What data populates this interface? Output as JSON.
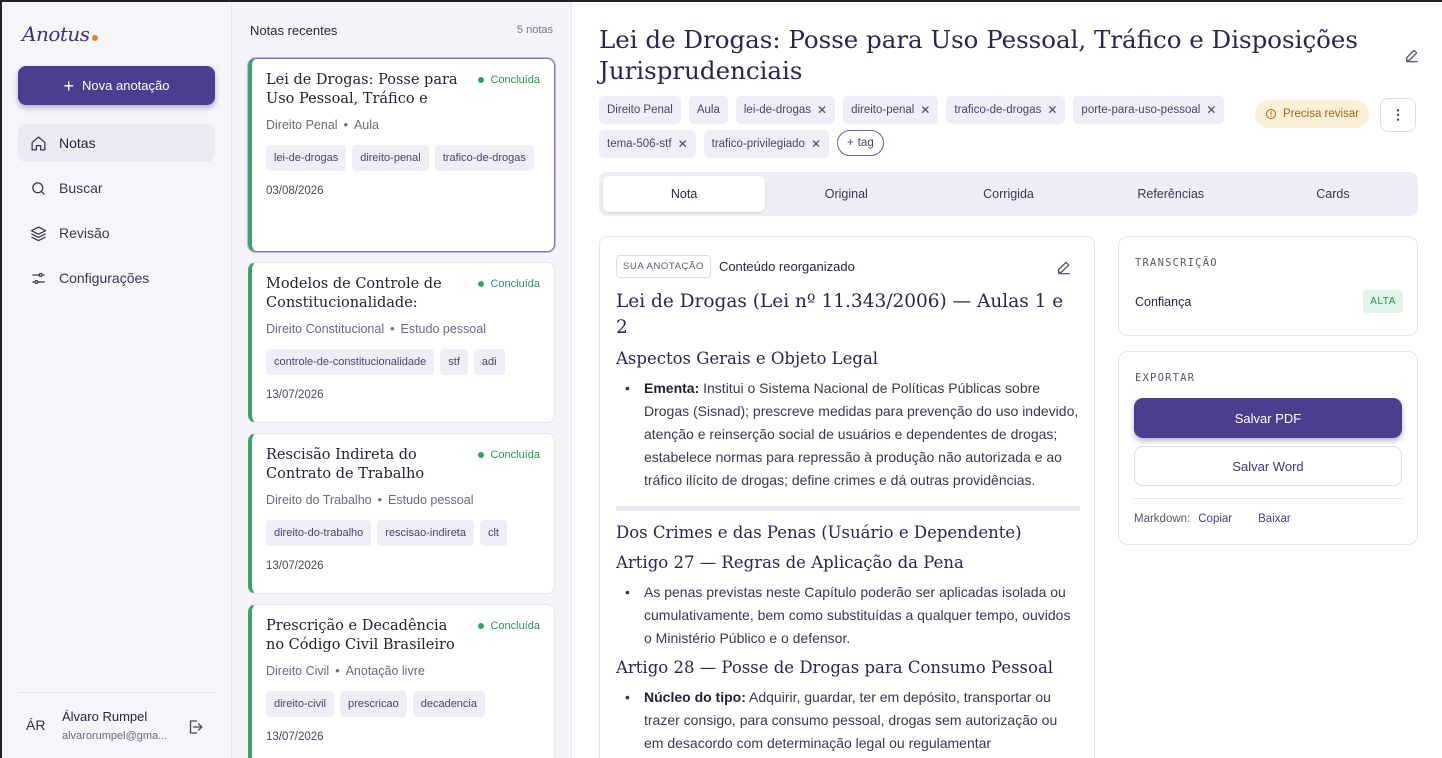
{
  "app": {
    "logo": "Anotus",
    "new_note_label": "Nova anotação"
  },
  "nav": [
    {
      "label": "Notas",
      "icon": "home-icon",
      "active": true
    },
    {
      "label": "Buscar",
      "icon": "search-icon"
    },
    {
      "label": "Revisão",
      "icon": "layers-icon"
    },
    {
      "label": "Configurações",
      "icon": "sliders-icon"
    }
  ],
  "user": {
    "initials": "ÁR",
    "name": "Álvaro Rumpel",
    "email": "alvarorumpel@gma..."
  },
  "notes_list": {
    "header": "Notas recentes",
    "count": "5 notas",
    "cards": [
      {
        "title": "Lei de Drogas: Posse para Uso Pessoal, Tráfico e Dis...",
        "status": "Concluída",
        "area": "Direito Penal",
        "type": "Aula",
        "tags": [
          "lei-de-drogas",
          "direito-penal",
          "trafico-de-drogas"
        ],
        "date": "03/08/2026"
      },
      {
        "title": "Modelos de Controle de Constitucionalidade: Difu...",
        "status": "Concluída",
        "area": "Direito Constitucional",
        "type": "Estudo pessoal",
        "tags": [
          "controle-de-constitucionalidade",
          "stf",
          "adi"
        ],
        "date": "13/07/2026"
      },
      {
        "title": "Rescisão Indireta do Contrato de Trabalho",
        "status": "Concluída",
        "area": "Direito do Trabalho",
        "type": "Estudo pessoal",
        "tags": [
          "direito-do-trabalho",
          "rescisao-indireta",
          "clt"
        ],
        "date": "13/07/2026"
      },
      {
        "title": "Prescrição e Decadência no Código Civil Brasileiro",
        "status": "Concluída",
        "area": "Direito Civil",
        "type": "Anotação livre",
        "tags": [
          "direito-civil",
          "prescricao",
          "decadencia"
        ],
        "date": "13/07/2026"
      }
    ]
  },
  "document": {
    "title": "Lei de Drogas: Posse para Uso Pessoal, Tráfico e Disposições Jurisprudenciais",
    "fixed_tags": [
      "Direito Penal",
      "Aula"
    ],
    "tags": [
      "lei-de-drogas",
      "direito-penal",
      "trafico-de-drogas",
      "porte-para-uso-pessoal",
      "tema-506-stf",
      "trafico-privilegiado"
    ],
    "add_tag_label": "tag",
    "review_label": "Precisa revisar",
    "tabs": [
      "Nota",
      "Original",
      "Corrigida",
      "Referências",
      "Cards"
    ],
    "active_tab": "Nota"
  },
  "note": {
    "badge": "SUA ANOTAÇÃO",
    "subtitle": "Conteúdo reorganizado",
    "h1": "Lei de Drogas (Lei nº 11.343/2006) — Aulas 1 e 2",
    "section1_h2": "Aspectos Gerais e Objeto Legal",
    "ementa_label": "Ementa:",
    "ementa_text": " Institui o Sistema Nacional de Políticas Públicas sobre Drogas (Sisnad); prescreve medidas para prevenção do uso indevido, atenção e reinserção social de usuários e dependentes de drogas; estabelece normas para repressão à produção não autorizada e ao tráfico ilícito de drogas; define crimes e dá outras providências.",
    "section2_h": "Dos Crimes e das Penas (Usuário e Dependente)",
    "art27_h": "Artigo 27 — Regras de Aplicação da Pena",
    "art27_text": "As penas previstas neste Capítulo poderão ser aplicadas isolada ou cumulativamente, bem como substituídas a qualquer tempo, ouvidos o Ministério Público e o defensor.",
    "art28_h": "Artigo 28 — Posse de Drogas para Consumo Pessoal",
    "nucleo_label": "Núcleo do tipo:",
    "nucleo_text": " Adquirir, guardar, ter em depósito, transportar ou trazer consigo, para consumo pessoal, drogas sem autorização ou em desacordo com determinação legal ou regulamentar"
  },
  "transcription": {
    "label": "TRANSCRIÇÃO",
    "confidence_label": "Confiança",
    "confidence_value": "ALTA"
  },
  "export": {
    "label": "EXPORTAR",
    "pdf": "Salvar PDF",
    "word": "Salvar Word",
    "markdown_label": "Markdown:",
    "copy": "Copiar",
    "download": "Baixar"
  },
  "colors": {
    "accent": "#4d3d8f",
    "success": "#34a35e",
    "warning_bg": "#fbefd8",
    "warning_text": "#9a6a1c"
  }
}
